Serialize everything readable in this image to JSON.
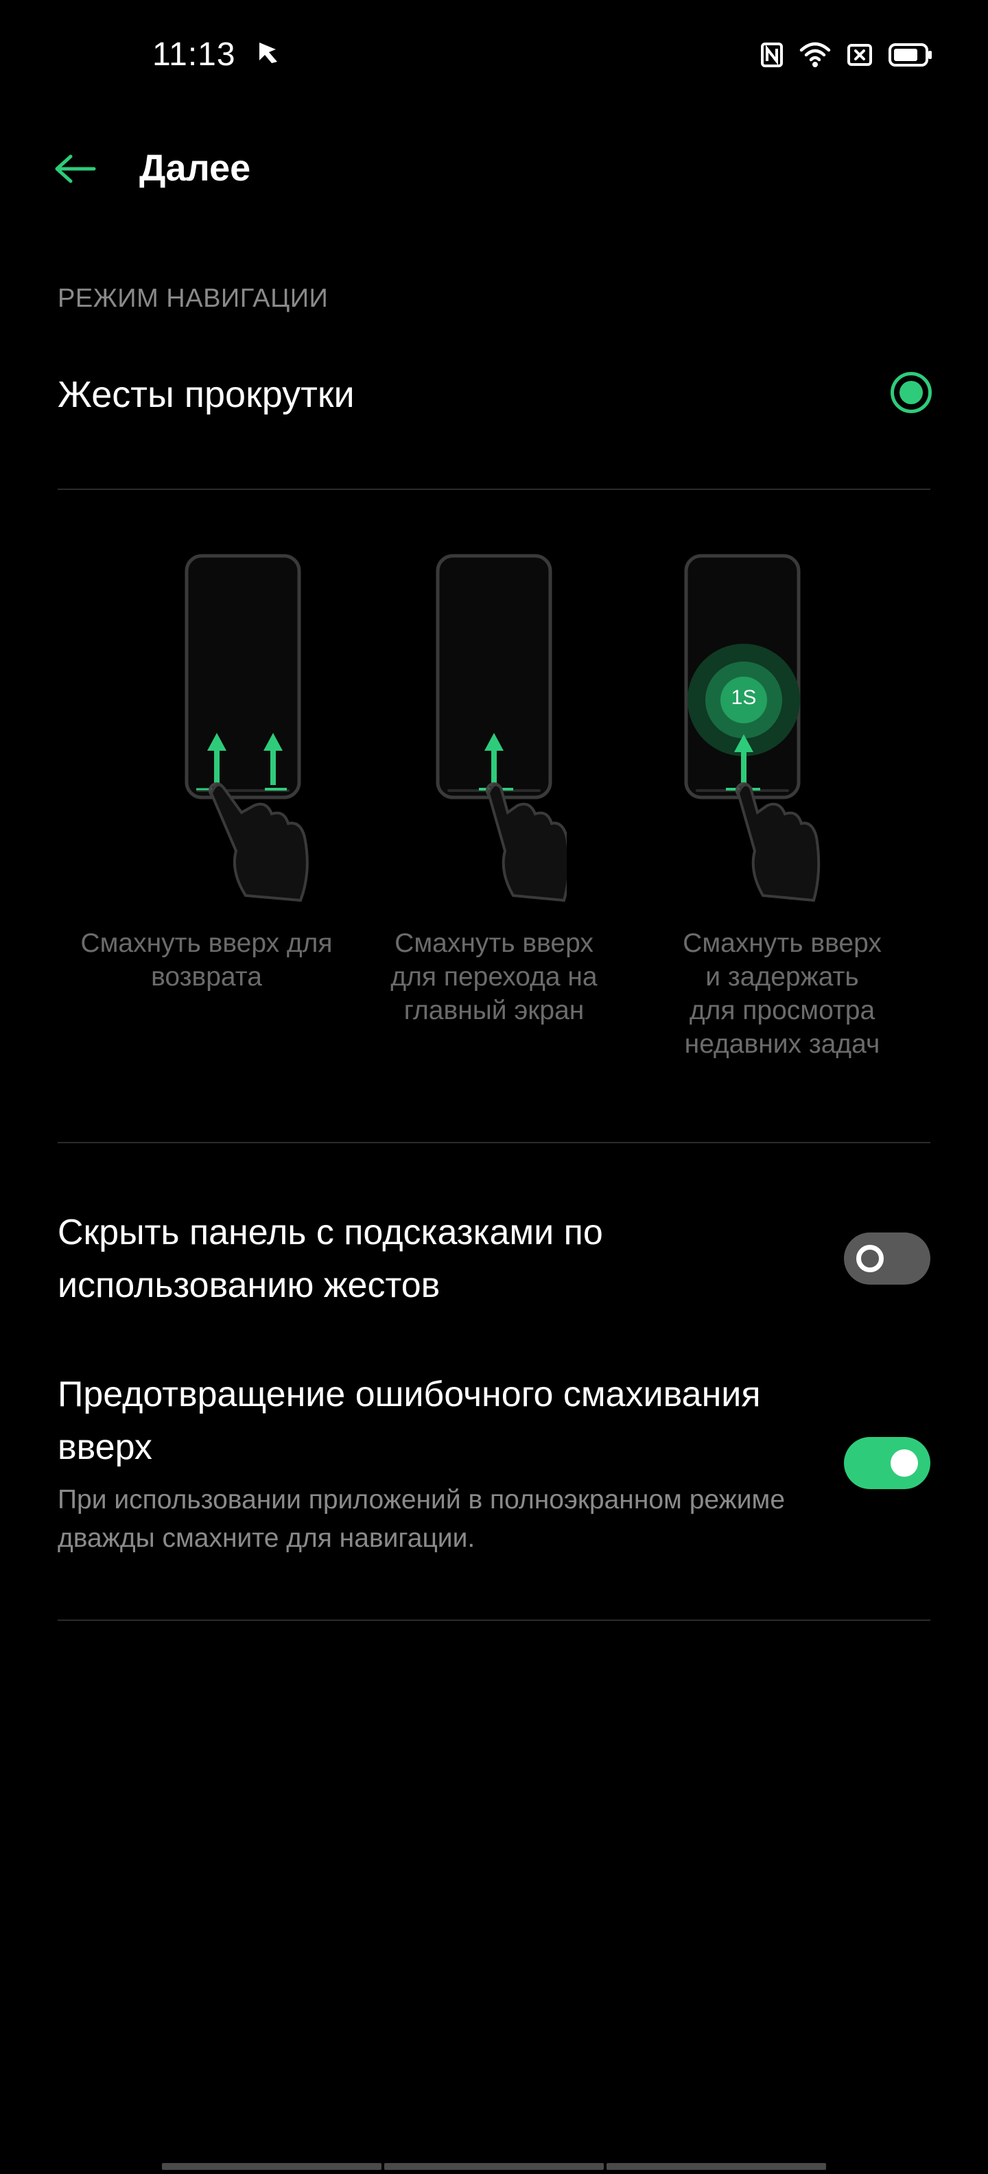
{
  "status_bar": {
    "time": "11:13",
    "app_icon": "app-notification-icon",
    "icons": [
      "nfc-icon",
      "wifi-icon",
      "close-box-icon",
      "battery-icon"
    ]
  },
  "header": {
    "back_icon": "back-arrow-icon",
    "title": "Далее"
  },
  "section": {
    "header": "РЕЖИМ НАВИГАЦИИ",
    "option_label": "Жесты прокрутки",
    "option_selected": true
  },
  "gestures": [
    {
      "caption_lines": [
        "Смахнуть вверх для",
        "возврата"
      ],
      "icon": "swipe-up-back-illustration"
    },
    {
      "caption_lines": [
        "Смахнуть вверх",
        "для перехода на",
        "главный экран"
      ],
      "icon": "swipe-up-home-illustration"
    },
    {
      "caption_lines": [
        "Смахнуть вверх",
        "и задержать",
        "для просмотра",
        "недавних задач"
      ],
      "icon": "swipe-up-hold-recents-illustration",
      "badge": "1S"
    }
  ],
  "toggles": [
    {
      "title": "Скрыть панель с подсказками по использованию жестов",
      "enabled": false
    },
    {
      "title": "Предотвращение ошибочного смахивания вверх",
      "subtitle": "При использовании приложений в полноэкранном режиме дважды смахните для навигации.",
      "enabled": true
    }
  ],
  "colors": {
    "accent": "#2ecc7a",
    "background": "#000000",
    "secondary_text": "#8a8a8a",
    "caption_text": "#6b6b6b"
  }
}
